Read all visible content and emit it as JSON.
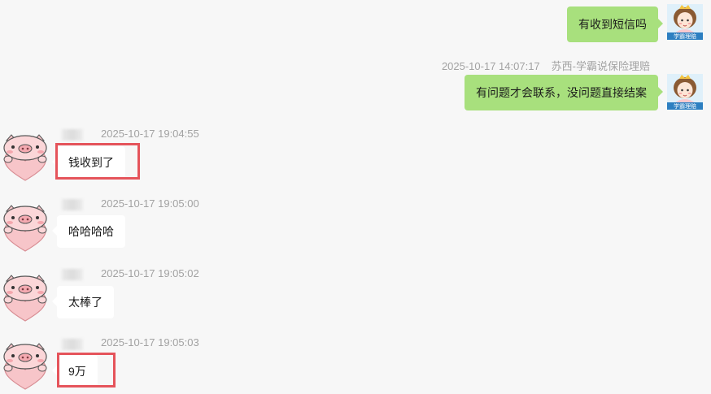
{
  "colors": {
    "outgoing_bubble": "#a8e07d",
    "incoming_bubble": "#ffffff",
    "background": "#f7f7f7",
    "highlight": "#e5545b",
    "meta_text": "#a2a2a2"
  },
  "outgoing": [
    {
      "text": "有收到短信吗",
      "avatar_label": "学霸理赔",
      "avatar_icon": "girl-cartoon-avatar-icon"
    },
    {
      "timestamp": "2025-10-17 14:07:17",
      "sender": "苏西-学霸说保险理赔",
      "text": "有问题才会联系，没问题直接结案",
      "avatar_label": "学霸理赔",
      "avatar_icon": "girl-cartoon-avatar-icon"
    }
  ],
  "incoming": [
    {
      "timestamp": "2025-10-17 19:04:55",
      "text": "钱收到了",
      "highlighted": true,
      "avatar_icon": "pig-heart-avatar-icon"
    },
    {
      "timestamp": "2025-10-17 19:05:00",
      "text": "哈哈哈哈",
      "highlighted": false,
      "avatar_icon": "pig-heart-avatar-icon"
    },
    {
      "timestamp": "2025-10-17 19:05:02",
      "text": "太棒了",
      "highlighted": false,
      "avatar_icon": "pig-heart-avatar-icon"
    },
    {
      "timestamp": "2025-10-17 19:05:03",
      "text": "9万",
      "highlighted": true,
      "avatar_icon": "pig-heart-avatar-icon"
    }
  ]
}
